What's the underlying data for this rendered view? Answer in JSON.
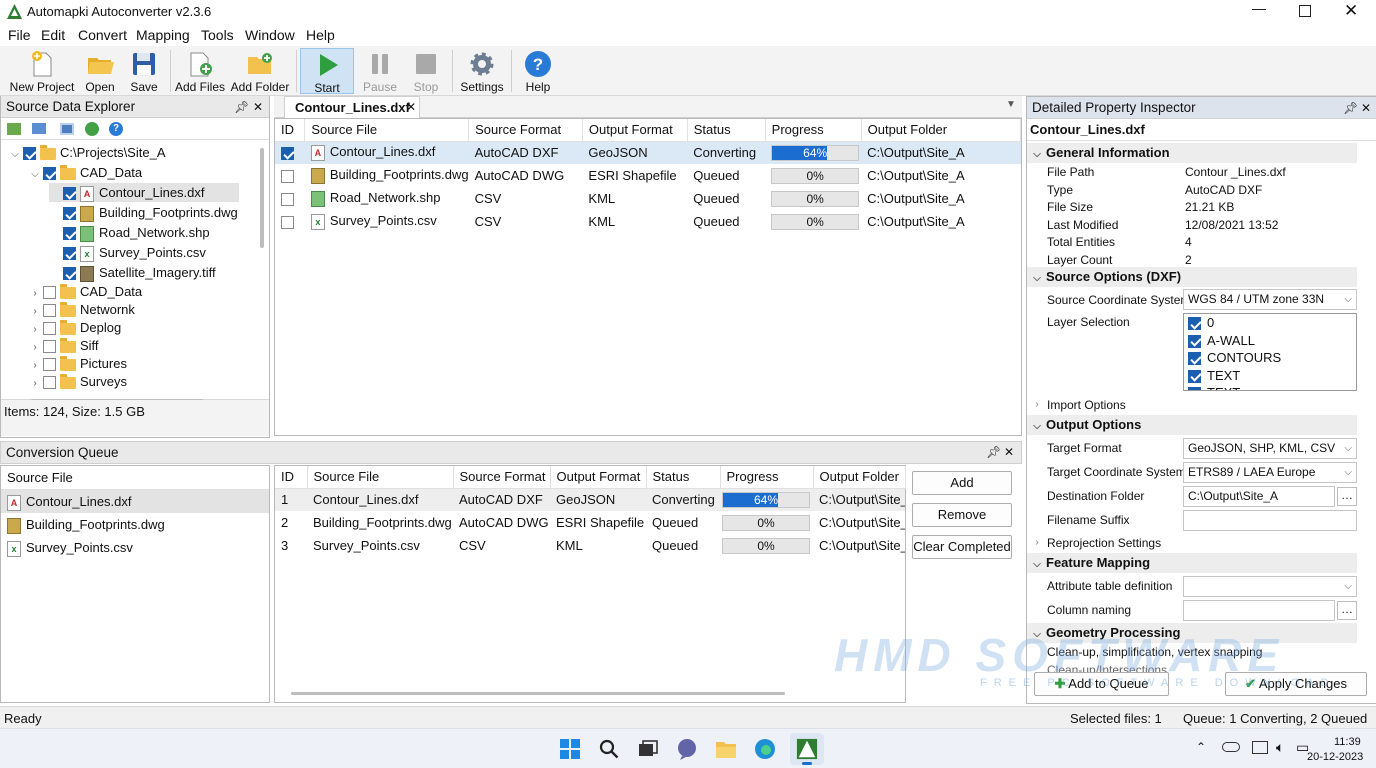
{
  "app": {
    "title": "Automapki Autoconverter v2.3.6"
  },
  "menu": [
    "File",
    "Edit",
    "Convert",
    "Mapping",
    "Tools",
    "Window",
    "Help"
  ],
  "toolbar": {
    "new_project": "New Project",
    "open": "Open",
    "save": "Save",
    "add_files": "Add Files",
    "add_folder": "Add Folder",
    "start": "Start",
    "pause": "Pause",
    "stop": "Stop",
    "settings": "Settings",
    "help": "Help"
  },
  "explorer": {
    "title": "Source Data Explorer",
    "tree": [
      {
        "label": "C:\\Projects\\Site_A",
        "checked": true,
        "expanded": true,
        "type": "folder",
        "level": 0
      },
      {
        "label": "CAD_Data",
        "checked": true,
        "expanded": true,
        "type": "folder",
        "level": 1
      },
      {
        "label": "Contour_Lines.dxf",
        "checked": true,
        "type": "dxf",
        "level": 2,
        "selected": true
      },
      {
        "label": "Building_Footprints.dwg",
        "checked": true,
        "type": "dwg",
        "level": 2
      },
      {
        "label": "Road_Network.shp",
        "checked": true,
        "type": "shp",
        "level": 2
      },
      {
        "label": "Survey_Points.csv",
        "checked": true,
        "type": "csv",
        "level": 2
      },
      {
        "label": "Satellite_Imagery.tiff",
        "checked": true,
        "type": "tif",
        "level": 2
      },
      {
        "label": "CAD_Data",
        "checked": false,
        "type": "folder",
        "level": 1,
        "collapsed": true
      },
      {
        "label": "Networnk",
        "checked": false,
        "type": "folder",
        "level": 1,
        "collapsed": true
      },
      {
        "label": "Deplog",
        "checked": false,
        "type": "folder",
        "level": 1,
        "collapsed": true
      },
      {
        "label": "Siff",
        "checked": false,
        "type": "folder",
        "level": 1,
        "collapsed": true
      },
      {
        "label": "Pictures",
        "checked": false,
        "type": "folder",
        "level": 1,
        "collapsed": true
      },
      {
        "label": "Surveys",
        "checked": false,
        "type": "folder",
        "level": 1,
        "collapsed": true
      }
    ],
    "status": "Items: 124, Size: 1.5 GB"
  },
  "doc_tab": {
    "label": "Contour_Lines.dxf"
  },
  "main_grid": {
    "columns": [
      "ID",
      "Source File",
      "Source Format",
      "Output Format",
      "Status",
      "Progress",
      "Output Folder"
    ],
    "rows": [
      {
        "checked": true,
        "type": "dxf",
        "file": "Contour_Lines.dxf",
        "src": "AutoCAD DXF",
        "out": "GeoJSON",
        "status": "Converting",
        "progress": 64,
        "progress_label": "64%",
        "folder": "C:\\Output\\Site_A"
      },
      {
        "checked": false,
        "type": "dwg",
        "file": "Building_Footprints.dwg",
        "src": "AutoCAD DWG",
        "out": "ESRI Shapefile",
        "status": "Queued",
        "progress": 0,
        "progress_label": "0%",
        "folder": "C:\\Output\\Site_A"
      },
      {
        "checked": false,
        "type": "shp",
        "file": "Road_Network.shp",
        "src": "CSV",
        "out": "KML",
        "status": "Queued",
        "progress": 0,
        "progress_label": "0%",
        "folder": "C:\\Output\\Site_A"
      },
      {
        "checked": false,
        "type": "csv",
        "file": "Survey_Points.csv",
        "src": "CSV",
        "out": "KML",
        "status": "Queued",
        "progress": 0,
        "progress_label": "0%",
        "folder": "C:\\Output\\Site_A"
      }
    ]
  },
  "queue": {
    "title": "Conversion Queue",
    "list_header": "Source File",
    "list": [
      {
        "type": "dxf",
        "label": "Contour_Lines.dxf"
      },
      {
        "type": "dwg",
        "label": "Building_Footprints.dwg"
      },
      {
        "type": "csv",
        "label": "Survey_Points.csv"
      }
    ],
    "columns": [
      "ID",
      "Source File",
      "Source Format",
      "Output Format",
      "Status",
      "Progress",
      "Output Folder"
    ],
    "rows": [
      {
        "id": "1",
        "file": "Contour_Lines.dxf",
        "src": "AutoCAD DXF",
        "out": "GeoJSON",
        "status": "Converting",
        "progress": 64,
        "progress_label": "64%",
        "folder": "C:\\Output\\Site_"
      },
      {
        "id": "2",
        "file": "Building_Footprints.dwg",
        "src": "AutoCAD DWG",
        "out": "ESRI Shapefile",
        "status": "Queued",
        "progress": 0,
        "progress_label": "0%",
        "folder": "C:\\Output\\Site_"
      },
      {
        "id": "3",
        "file": "Survey_Points.csv",
        "src": "CSV",
        "out": "KML",
        "status": "Queued",
        "progress": 0,
        "progress_label": "0%",
        "folder": "C:\\Output\\Site_"
      }
    ],
    "add": "Add",
    "remove": "Remove",
    "clear": "Clear Completed"
  },
  "inspector": {
    "title": "Detailed Property Inspector",
    "file": "Contour_Lines.dxf",
    "general": {
      "title": "General Information",
      "rows": [
        [
          "File Path",
          "Contour _Lines.dxf"
        ],
        [
          "Type",
          "AutoCAD DXF"
        ],
        [
          "File Size",
          "21.21 KB"
        ],
        [
          "Last Modified",
          "12/08/2021 13:52"
        ],
        [
          "Total Entities",
          "4"
        ],
        [
          "Layer Count",
          "2"
        ]
      ]
    },
    "source": {
      "title": "Source Options (DXF)",
      "crs_label": "Source Coordinate System",
      "crs": "WGS 84 / UTM zone 33N",
      "layer_label": "Layer Selection",
      "layers": [
        "0",
        "A-WALL",
        "CONTOURS",
        "TEXT",
        "TEXT"
      ]
    },
    "import_options": "Import Options",
    "output": {
      "title": "Output Options",
      "target_format_label": "Target Format",
      "target_format": "GeoJSON, SHP, KML, CSV",
      "target_crs_label": "Target Coordinate System",
      "target_crs": "ETRS89 / LAEA Europe",
      "dest_label": "Destination Folder",
      "dest": "C:\\Output\\Site_A",
      "suffix_label": "Filename Suffix",
      "suffix": ""
    },
    "reprojection": "Reprojection Settings",
    "feature": {
      "title": "Feature Mapping",
      "attr_label": "Attribute table definition",
      "attr": "",
      "col_label": "Column naming",
      "col": ""
    },
    "geometry": {
      "title": "Geometry Processing",
      "desc": "Clean-up, simplification, vertex snapping",
      "desc2": "Clean-up/Intersections"
    },
    "add_queue": "Add to Queue",
    "apply": "Apply Changes"
  },
  "watermark": {
    "text": "HMD SOFTWARE",
    "sub": "FREE PC SOFTWARE DOWNLOAD"
  },
  "status": {
    "left": "Ready",
    "selected": "Selected files: 1",
    "queue": "Queue: 1 Converting, 2 Queued"
  },
  "taskbar": {
    "time": "11:39",
    "date": "20-12-2023"
  },
  "colors": {
    "accent": "#1c6dd0",
    "panel_header": "#e9e9e9"
  }
}
